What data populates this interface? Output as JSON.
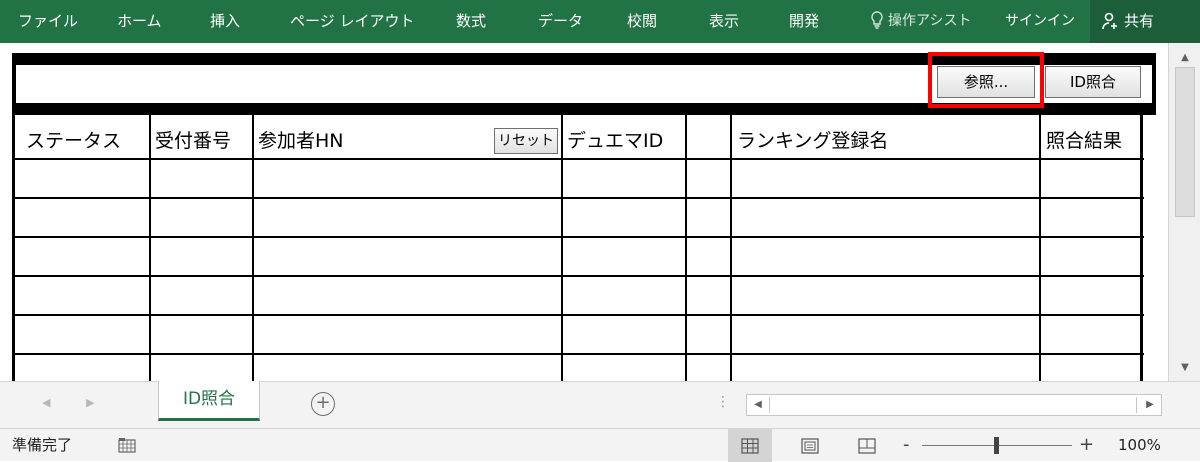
{
  "ribbon": {
    "tabs": [
      "ファイル",
      "ホーム",
      "挿入",
      "ページ レイアウト",
      "数式",
      "データ",
      "校閲",
      "表示",
      "開発"
    ],
    "assist_label": "操作アシスト",
    "signin_label": "サインイン",
    "share_label": "共有",
    "color": "#217346"
  },
  "toolbar": {
    "reference_button": "参照...",
    "id_match_button": "ID照合",
    "highlight_color": "#ff0000"
  },
  "table": {
    "columns": [
      "ステータス",
      "受付番号",
      "参加者HN",
      "デュエマID",
      "",
      "ランキング登録名",
      "照合結果"
    ],
    "reset_button": "リセット",
    "row_count": 6
  },
  "sheet_tabs": {
    "active": "ID照合",
    "add_icon": "plus-circle-icon"
  },
  "status": {
    "ready_text": "準備完了",
    "zoom_level": "100%",
    "zoom_minus": "-",
    "zoom_plus": "+"
  }
}
